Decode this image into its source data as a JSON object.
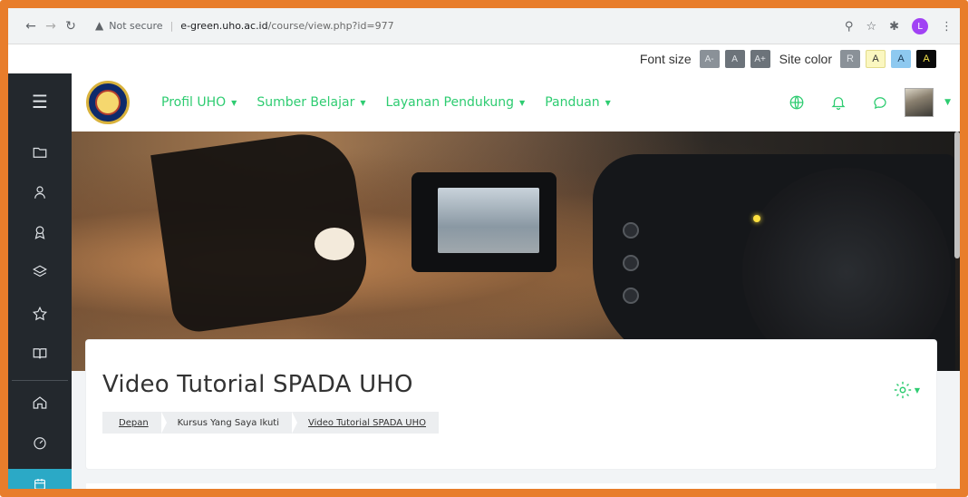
{
  "browser": {
    "security_label": "Not secure",
    "url_host": "e-green.uho.ac.id",
    "url_path": "/course/view.php?id=977",
    "profile_initial": "L"
  },
  "accessibility": {
    "font_size_label": "Font size",
    "font_buttons": [
      "A-",
      "A",
      "A+"
    ],
    "site_color_label": "Site color",
    "color_buttons": [
      "R",
      "A",
      "A",
      "A"
    ]
  },
  "nav": {
    "menu": [
      {
        "label": "Profil UHO"
      },
      {
        "label": "Sumber Belajar"
      },
      {
        "label": "Layanan Pendukung"
      },
      {
        "label": "Panduan"
      }
    ]
  },
  "course": {
    "title": "Video Tutorial SPADA UHO",
    "breadcrumb": [
      "Depan",
      "Kursus Yang Saya Ikuti",
      "Video Tutorial SPADA UHO"
    ]
  },
  "icons": {
    "sidebar": [
      "hamburger-icon",
      "folder-icon",
      "participants-icon",
      "badge-icon",
      "layers-icon",
      "star-icon",
      "book-icon",
      "home-icon",
      "dashboard-icon",
      "calendar-icon"
    ],
    "nav_right": [
      "globe-icon",
      "bell-icon",
      "chat-icon"
    ]
  },
  "colors": {
    "accent": "#2ecc71",
    "sidebar_bg": "#23282d",
    "sidebar_active": "#2ba9c6",
    "frame": "#e87d2b"
  }
}
